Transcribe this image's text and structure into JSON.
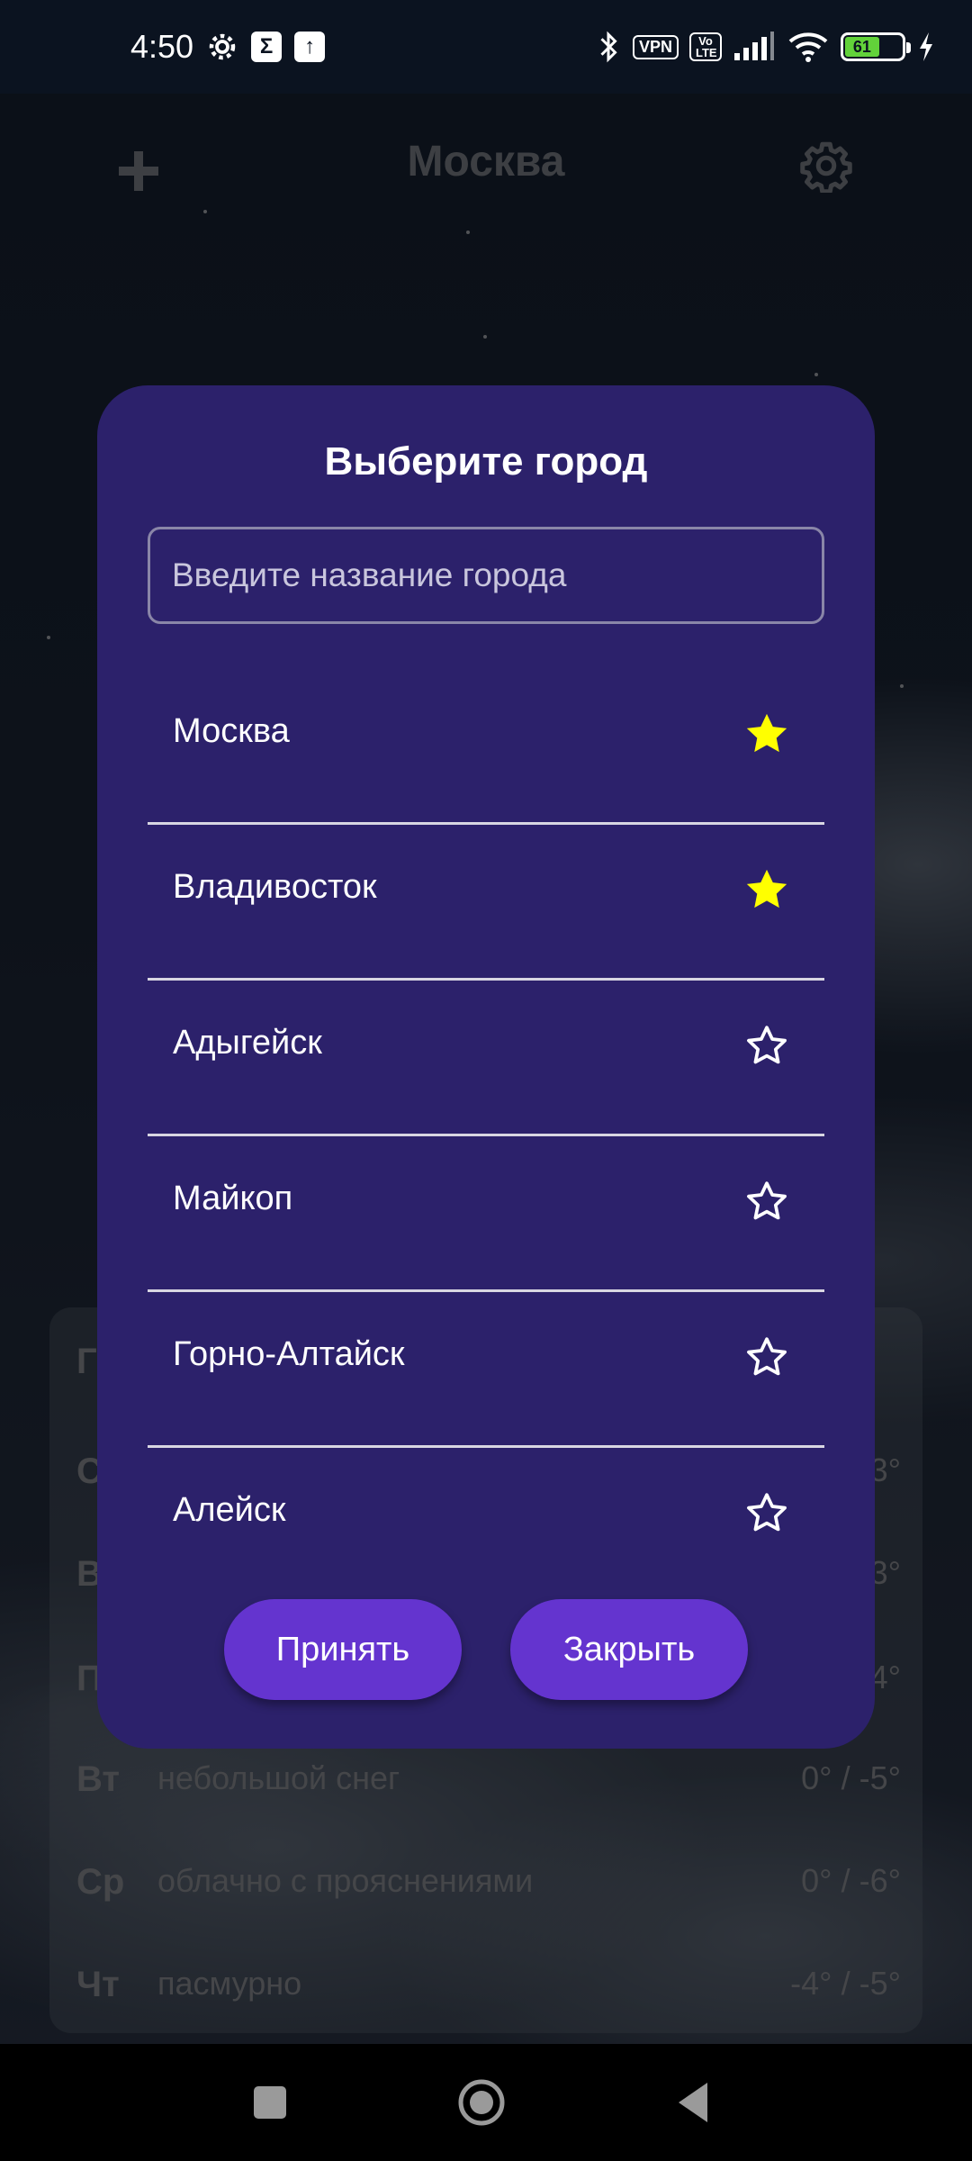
{
  "status_bar": {
    "time": "4:50",
    "vpn_label": "VPN",
    "volte_label": "Vo LTE",
    "battery_level": "61"
  },
  "app_bar": {
    "city_title": "Москва"
  },
  "dialog": {
    "title": "Выберите город",
    "search_placeholder": "Введите название города",
    "cities": [
      {
        "name": "Москва",
        "favorite": true
      },
      {
        "name": "Владивосток",
        "favorite": true
      },
      {
        "name": "Адыгейск",
        "favorite": false
      },
      {
        "name": "Майкоп",
        "favorite": false
      },
      {
        "name": "Горно-Алтайск",
        "favorite": false
      },
      {
        "name": "Алейск",
        "favorite": false
      }
    ],
    "accept_label": "Принять",
    "close_label": "Закрыть"
  },
  "forecast": {
    "rows": [
      {
        "day": "Г",
        "desc": "",
        "temp": ""
      },
      {
        "day": "С",
        "desc": "",
        "temp": "3°"
      },
      {
        "day": "В",
        "desc": "",
        "temp": "3°"
      },
      {
        "day": "П",
        "desc": "",
        "temp": "4°"
      },
      {
        "day": "Вт",
        "desc": "небольшой снег",
        "temp": "0° / -5°"
      },
      {
        "day": "Ср",
        "desc": "облачно с прояснениями",
        "temp": "0° / -6°"
      },
      {
        "day": "Чт",
        "desc": "пасмурно",
        "temp": "-4° / -5°"
      }
    ]
  },
  "colors": {
    "dialog_bg": "#2c216b",
    "button_bg": "#6434cf",
    "favorite_star": "#ffff00",
    "muted_text": "#8a8d92"
  }
}
